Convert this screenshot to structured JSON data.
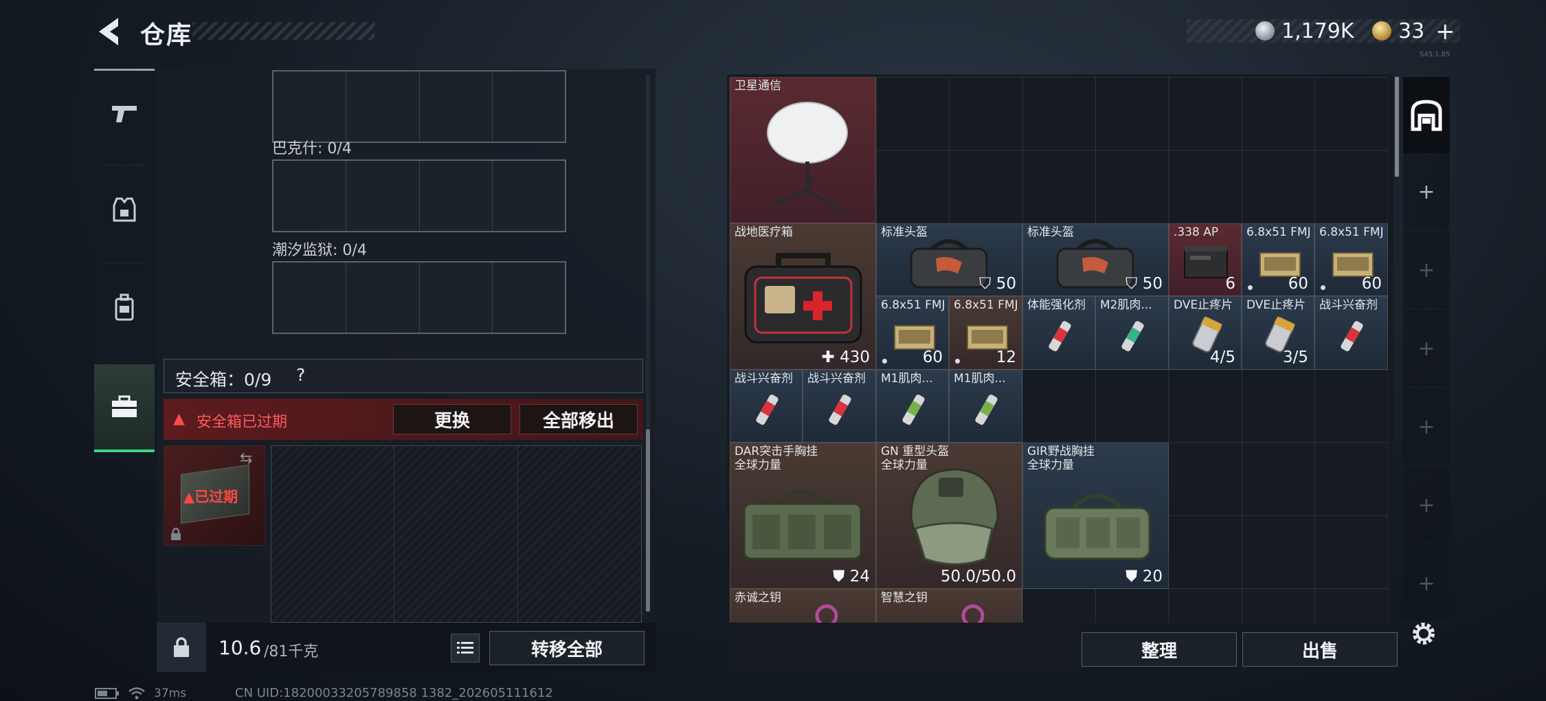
{
  "header": {
    "title": "仓库",
    "currency": {
      "silver_value": "1,179K",
      "gold_value": "33",
      "gold_plus": "+"
    },
    "version_tag": "S45.1.85"
  },
  "left_tabs": [
    {
      "name": "weapons",
      "icon": "pistol-icon"
    },
    {
      "name": "armor",
      "icon": "vest-icon"
    },
    {
      "name": "backpack",
      "icon": "backpack-icon"
    },
    {
      "name": "safe-case",
      "icon": "briefcase-icon",
      "active": true
    }
  ],
  "storage": {
    "slots": [
      {
        "label": "巴克什: 0/4"
      },
      {
        "label": "潮汐监狱: 0/4"
      }
    ],
    "safe_box": {
      "title": "安全箱：0/9",
      "help": "?",
      "expired_text": "安全箱已过期",
      "replace_label": "更换",
      "remove_all_label": "全部移出",
      "case_expired_label": "已过期"
    },
    "footer": {
      "weight_current": "10.6",
      "weight_max": "/81千克",
      "transfer_all_label": "转移全部"
    }
  },
  "inventory": {
    "items": [
      {
        "name": "卫星通信",
        "color": "red",
        "pic": "satellite-dish"
      },
      {
        "name": "战地医疗箱",
        "value": "430",
        "prefix": "✚",
        "color": "brown",
        "pic": "medkit"
      },
      {
        "name": "标准头盔",
        "value": "50",
        "prefix": "shield",
        "color": "blue",
        "pic": "bag"
      },
      {
        "name": "标准头盔",
        "value": "50",
        "prefix": "shield",
        "color": "blue",
        "pic": "bag"
      },
      {
        "name": ".338 AP",
        "value": "6",
        "color": "red",
        "pic": "ammo-box"
      },
      {
        "name": "6.8x51 FMJ",
        "value": "60",
        "color": "blue",
        "pic": "ammo"
      },
      {
        "name": "6.8x51 FMJ",
        "value": "60",
        "color": "blue",
        "pic": "ammo"
      },
      {
        "name": "6.8x51 FMJ",
        "value": "60",
        "color": "blue",
        "pic": "ammo"
      },
      {
        "name": "6.8x51 FMJ",
        "value": "12",
        "color": "brown",
        "pic": "ammo"
      },
      {
        "name": "体能强化剂",
        "color": "blue",
        "pic": "injector-red"
      },
      {
        "name": "M2肌肉...",
        "color": "blue",
        "pic": "injector-green"
      },
      {
        "name": "DVE止疼片",
        "value": "4/5",
        "color": "blue",
        "pic": "pills"
      },
      {
        "name": "DVE止疼片",
        "value": "3/5",
        "color": "blue",
        "pic": "pills"
      },
      {
        "name": "战斗兴奋剂",
        "color": "blue",
        "pic": "injector-red"
      },
      {
        "name": "战斗兴奋剂",
        "color": "blue",
        "pic": "injector-red"
      },
      {
        "name": "战斗兴奋剂",
        "color": "blue",
        "pic": "injector-red"
      },
      {
        "name": "M1肌肉...",
        "color": "blue",
        "pic": "injector-green"
      },
      {
        "name": "M1肌肉...",
        "color": "blue",
        "pic": "injector-green"
      },
      {
        "name": "DAR突击手胸挂",
        "sub": "全球力量",
        "value": "24",
        "prefix": "vest",
        "color": "brown",
        "pic": "chest-rig"
      },
      {
        "name": "GN 重型头盔",
        "sub": "全球力量",
        "value": "50.0/50.0",
        "color": "brown",
        "pic": "helmet"
      },
      {
        "name": "GIR野战胸挂",
        "sub": "全球力量",
        "value": "20",
        "prefix": "vest",
        "color": "blue",
        "pic": "chest-rig"
      },
      {
        "name": "赤诚之钥",
        "color": "brown",
        "pic": "key"
      },
      {
        "name": "智慧之钥",
        "color": "brown",
        "pic": "key"
      }
    ],
    "sort_label": "整理",
    "sell_label": "出售"
  },
  "right_tabs": [
    {
      "icon": "storage-icon",
      "active": true
    },
    {
      "icon": "plus-icon",
      "label": "+"
    },
    {
      "icon": "plus-icon",
      "label": "+"
    },
    {
      "icon": "plus-icon",
      "label": "+"
    },
    {
      "icon": "plus-icon",
      "label": "+"
    },
    {
      "icon": "plus-icon",
      "label": "+"
    },
    {
      "icon": "plus-icon",
      "label": "+"
    }
  ],
  "status": {
    "ping": "37ms",
    "uid": "CN UID:18200033205789858 1382_202605111612"
  }
}
